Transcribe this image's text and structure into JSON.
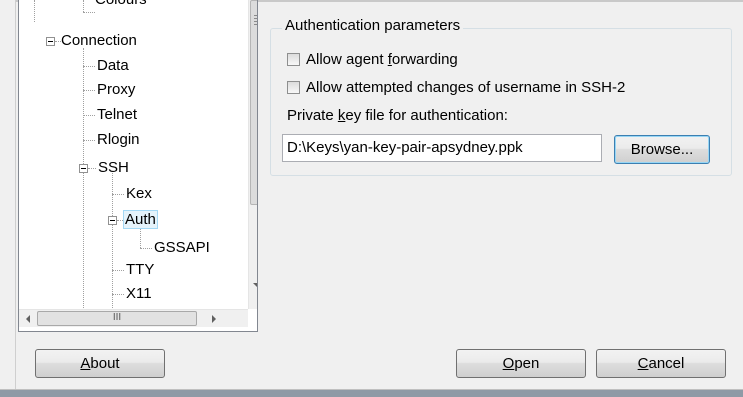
{
  "tree": {
    "items": [
      {
        "label": "Colours"
      },
      {
        "label": "Connection"
      },
      {
        "label": "Data"
      },
      {
        "label": "Proxy"
      },
      {
        "label": "Telnet"
      },
      {
        "label": "Rlogin"
      },
      {
        "label": "SSH"
      },
      {
        "label": "Kex"
      },
      {
        "label": "Auth"
      },
      {
        "label": "GSSAPI"
      },
      {
        "label": "TTY"
      },
      {
        "label": "X11"
      }
    ],
    "selected": "Auth",
    "hscroll_grip": "III"
  },
  "auth_group": {
    "title": "Authentication parameters",
    "agent_forwarding": {
      "pre": "Allow agent ",
      "key": "f",
      "post": "orwarding",
      "checked": false
    },
    "username_changes": {
      "label": "Allow attempted changes of username in SSH-2",
      "checked": false
    },
    "key_file_label": {
      "pre": "Private ",
      "key": "k",
      "post": "ey file for authentication:"
    },
    "key_file_value": "D:\\Keys\\yan-key-pair-apsydney.ppk",
    "browse_label": "Browse..."
  },
  "buttons": {
    "about": {
      "key": "A",
      "post": "bout"
    },
    "open": {
      "key": "O",
      "post": "pen"
    },
    "cancel": {
      "key": "C",
      "post": "ancel"
    }
  }
}
